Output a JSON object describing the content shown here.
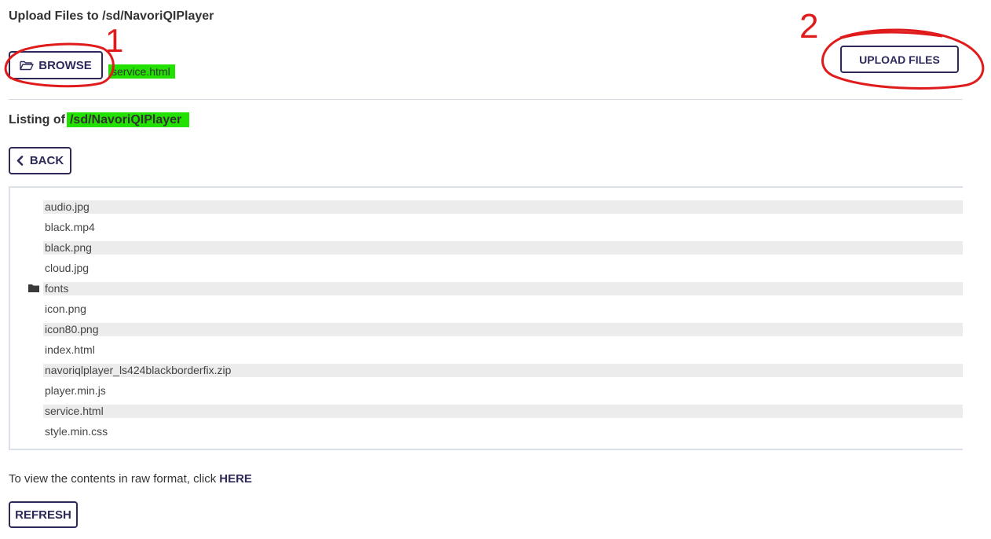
{
  "upload": {
    "title": "Upload Files to /sd/NavoriQIPlayer",
    "browse_label": "BROWSE",
    "selected_file": "service.html",
    "upload_label": "UPLOAD FILES"
  },
  "listing": {
    "prefix": "Listing of",
    "path": "/sd/NavoriQIPlayer",
    "back_label": "BACK",
    "files": [
      {
        "name": "audio.jpg",
        "type": "file"
      },
      {
        "name": "black.mp4",
        "type": "file"
      },
      {
        "name": "black.png",
        "type": "file"
      },
      {
        "name": "cloud.jpg",
        "type": "file"
      },
      {
        "name": "fonts",
        "type": "folder"
      },
      {
        "name": "icon.png",
        "type": "file"
      },
      {
        "name": "icon80.png",
        "type": "file"
      },
      {
        "name": "index.html",
        "type": "file"
      },
      {
        "name": "navoriqlplayer_ls424blackborderfix.zip",
        "type": "file"
      },
      {
        "name": "player.min.js",
        "type": "file"
      },
      {
        "name": "service.html",
        "type": "file"
      },
      {
        "name": "style.min.css",
        "type": "file"
      }
    ]
  },
  "footer": {
    "raw_text": "To view the contents in raw format, click",
    "raw_link": "HERE",
    "refresh_label": "REFRESH"
  },
  "annotations": {
    "marker_1": "1",
    "marker_2": "2",
    "color": "#e01b1b"
  },
  "colors": {
    "accent": "#2d2a5a",
    "highlight": "#22e000",
    "row_alt": "#ececec"
  },
  "icons": {
    "browse": "folder-open-icon",
    "back": "chevron-left-icon",
    "folder": "folder-icon"
  }
}
